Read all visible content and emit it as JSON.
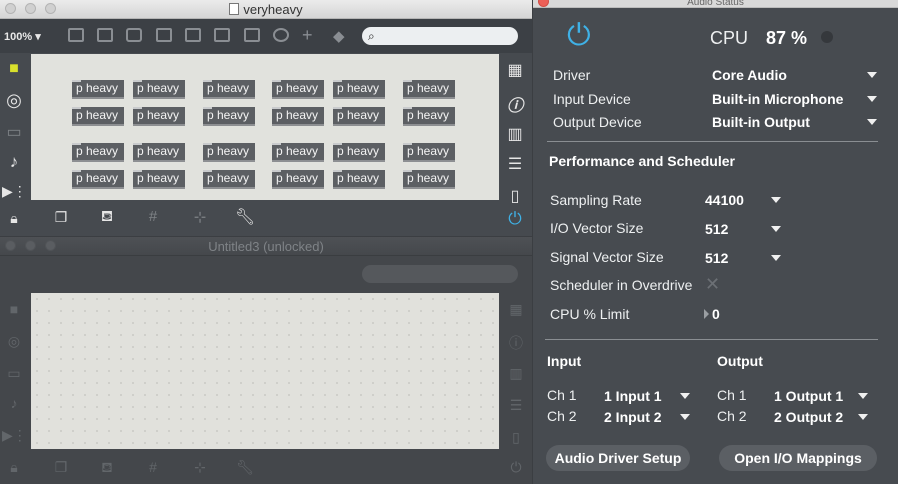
{
  "window_veryheavy": {
    "title": "veryheavy",
    "zoom": "100%",
    "object_label": "p heavy",
    "object_rows": 4,
    "object_columns": 6
  },
  "window_untitled": {
    "title": "Untitled3 (unlocked)"
  },
  "audio_status": {
    "title": "Audio Status",
    "cpu_label": "CPU",
    "cpu_value": "87 %",
    "driver": {
      "label": "Driver",
      "value": "Core Audio"
    },
    "input_device": {
      "label": "Input Device",
      "value": "Built-in Microphone"
    },
    "output_device": {
      "label": "Output Device",
      "value": "Built-in Output"
    },
    "perf_heading": "Performance and Scheduler",
    "sampling_rate": {
      "label": "Sampling Rate",
      "value": "44100"
    },
    "io_vector": {
      "label": "I/O Vector Size",
      "value": "512"
    },
    "signal_vector": {
      "label": "Signal Vector Size",
      "value": "512"
    },
    "overdrive": {
      "label": "Scheduler in Overdrive"
    },
    "cpu_limit": {
      "label": "CPU % Limit",
      "value": "0"
    },
    "input_heading": "Input",
    "output_heading": "Output",
    "inputs": [
      {
        "ch": "Ch 1",
        "value": "1 Input 1"
      },
      {
        "ch": "Ch 2",
        "value": "2 Input 2"
      }
    ],
    "outputs": [
      {
        "ch": "Ch 1",
        "value": "1 Output 1"
      },
      {
        "ch": "Ch 2",
        "value": "2 Output 2"
      }
    ],
    "driver_setup_button": "Audio Driver Setup",
    "io_mappings_button": "Open I/O Mappings",
    "power_color": "#3fb1e6"
  }
}
